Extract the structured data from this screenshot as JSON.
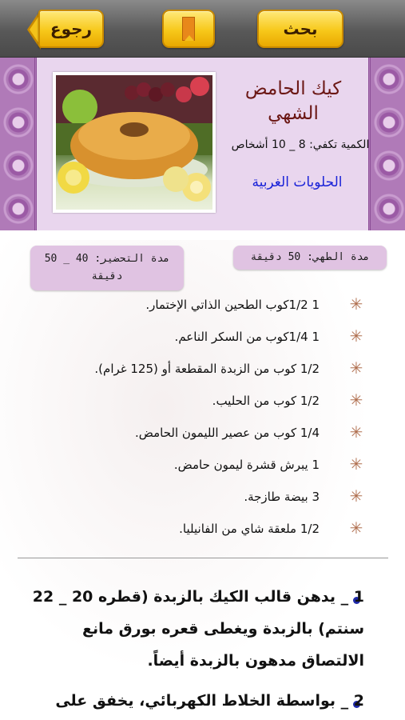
{
  "toolbar": {
    "back_label": "رجوع",
    "search_label": "بحث"
  },
  "recipe": {
    "title": "كيك الحامض الشهي",
    "serves": "الكمية تكفي: 8 _ 10 أشخاص",
    "category": "الحلويات الغربية"
  },
  "times": {
    "cook": "مدة الطهي: 50 دقيقة",
    "prep": "مدة التحضير: 40 _ 50 دقيقة"
  },
  "ingredients": [
    {
      "text": "1 1/2كوب الطحين الذاتي الإختمار."
    },
    {
      "text": "1 1/4كوب من السكر الناعم."
    },
    {
      "text": "1/2 كوب من الزبدة المقطعة أو (125 غرام)."
    },
    {
      "text": "1/2 كوب من الحليب."
    },
    {
      "text": "1/4 كوب من عصير الليمون الحامض."
    },
    {
      "text": "1 يبرش قشرة ليمون حامض."
    },
    {
      "text": "3 بيضة طازجة."
    },
    {
      "text": "1/2 ملعقة شاي من الفانيليا."
    }
  ],
  "steps": [
    {
      "text": "1 _ يدهن قالب الكيك بالزبدة (قطره 20 _ 22 سنتم) بالزبدة ويغطى قعره بورق مانع الالتصاق مدهون بالزبدة أيضاً."
    },
    {
      "text": "2 _ بواسطة الخلاط الكهربائي، يخفق على"
    }
  ],
  "colors": {
    "button": "#f7c81a",
    "panel": "#e9d6ee",
    "title": "#6b1714",
    "category": "#1a23d8",
    "badge": "#e0c3e2",
    "star": "#b06f4f",
    "bullet": "#1f2aa8"
  },
  "icons": {
    "back": "back-arrow-icon",
    "bookmark": "bookmark-icon",
    "ingredient": "asterisk-icon",
    "step": "bullet-icon"
  }
}
